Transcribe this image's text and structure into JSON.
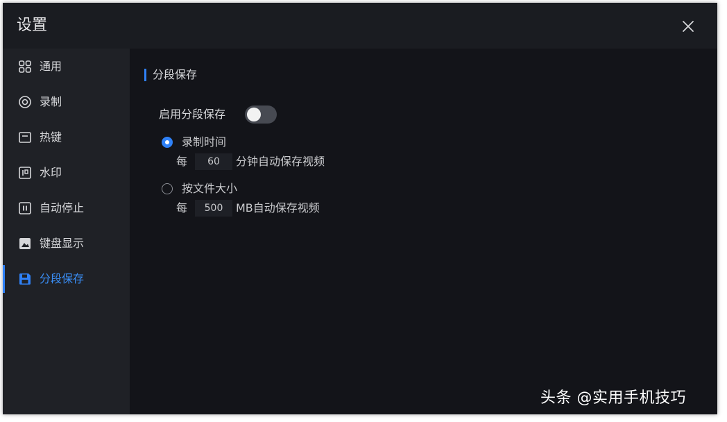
{
  "window": {
    "title": "设置"
  },
  "sidebar": {
    "items": [
      {
        "label": "通用",
        "icon": "grid-icon"
      },
      {
        "label": "录制",
        "icon": "record-icon"
      },
      {
        "label": "热键",
        "icon": "hotkey-icon"
      },
      {
        "label": "水印",
        "icon": "watermark-icon"
      },
      {
        "label": "自动停止",
        "icon": "pause-icon"
      },
      {
        "label": "键盘显示",
        "icon": "keyboard-display-icon"
      },
      {
        "label": "分段保存",
        "icon": "floppy-save-icon",
        "active": true
      }
    ]
  },
  "content": {
    "section_title": "分段保存",
    "enable_label": "启用分段保存",
    "enable_on": false,
    "options": [
      {
        "label": "录制时间",
        "checked": true,
        "prefix": "每",
        "value": "60",
        "suffix": "分钟自动保存视频"
      },
      {
        "label": "按文件大小",
        "checked": false,
        "prefix": "每",
        "value": "500",
        "suffix": "MB自动保存视频"
      }
    ]
  },
  "watermark": {
    "text": "头条 @实用手机技巧"
  },
  "colors": {
    "accent": "#2f81f7",
    "window_bg": "#1a1c21",
    "sidebar_bg": "#1f2126",
    "content_bg": "#131419",
    "text": "#d6d7da"
  }
}
